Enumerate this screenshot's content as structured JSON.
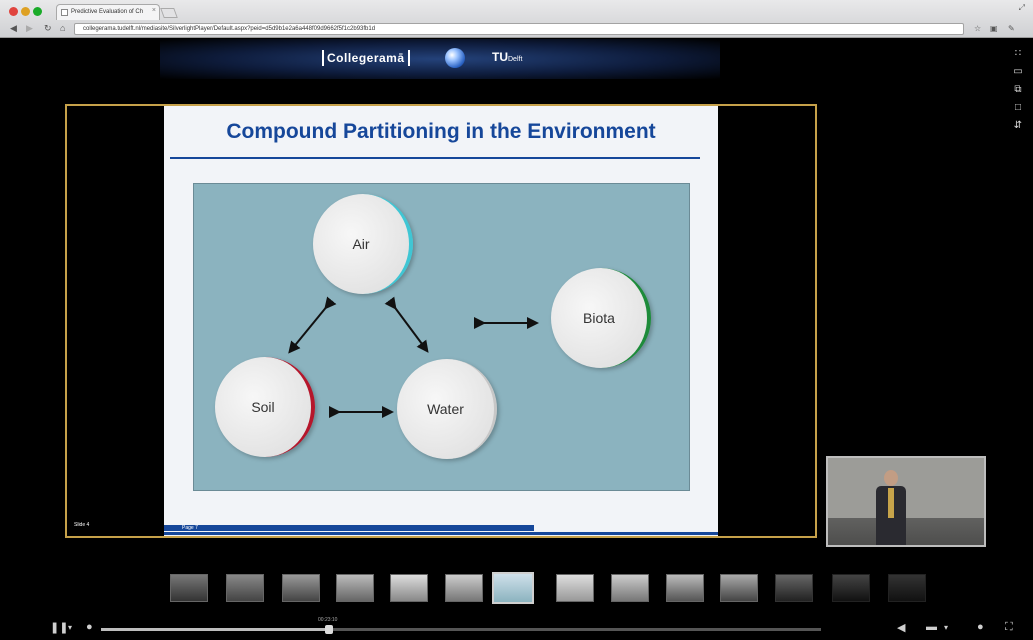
{
  "browser": {
    "tab_title": "Predictive Evaluation of Ch",
    "tab_close": "×",
    "url": "collegerama.tudelft.nl/mediasite/SilverlightPlayer/Default.aspx?peid=d5d9b1e2a6a448f09d9662f5f1c2b93fb1d",
    "back_icon": "arrow-left-icon",
    "forward_icon": "arrow-right-icon",
    "reload_icon": "reload-icon"
  },
  "banner": {
    "logo_text": "Collegeramā",
    "tu_text": "TU",
    "tu_small": "Delft"
  },
  "slide": {
    "title": "Compound Partitioning in the Environment",
    "slide_number": "Slide 4",
    "page_label": "Page 7",
    "nodes": {
      "air": "Air",
      "soil": "Soil",
      "water": "Water",
      "biota": "Biota"
    }
  },
  "player": {
    "time_label": "00:23:10",
    "colors": {
      "frame": "#c6a14a",
      "title": "#16479a",
      "diagram_bg": "#8bb3bf",
      "air_accent": "#3fc6d4",
      "soil_accent": "#b5162b",
      "biota_accent": "#1d8b3a"
    }
  }
}
